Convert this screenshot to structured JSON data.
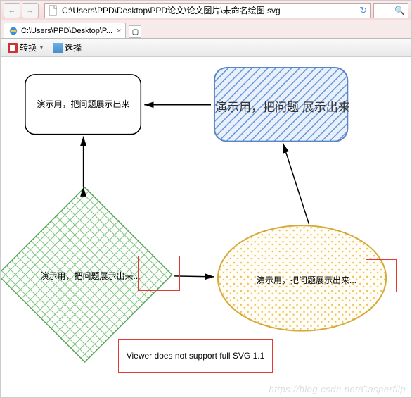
{
  "titlebar": {
    "back_tip": "Back",
    "fwd_tip": "Forward",
    "url": "C:\\Users\\PPD\\Desktop\\PPD论文\\论文图片\\未命名绘图.svg",
    "refresh_tip": "Refresh",
    "search_placeholder": ""
  },
  "tab": {
    "title": "C:\\Users\\PPD\\Desktop\\P...",
    "close": "×",
    "new": "▢"
  },
  "toolbar": {
    "convert": "转换",
    "select": "选择"
  },
  "diagram": {
    "rect_text": "演示用，把问题展示出来",
    "hatched_text": "演示用，把问题 展示出来",
    "diamond_text": "演示用，把问题展示出来...",
    "ellipse_text": "演示用，把问题展示出来...",
    "warning": "Viewer does not support full SVG 1.1"
  },
  "watermark": "https://blog.csdn.net/Casperflip"
}
